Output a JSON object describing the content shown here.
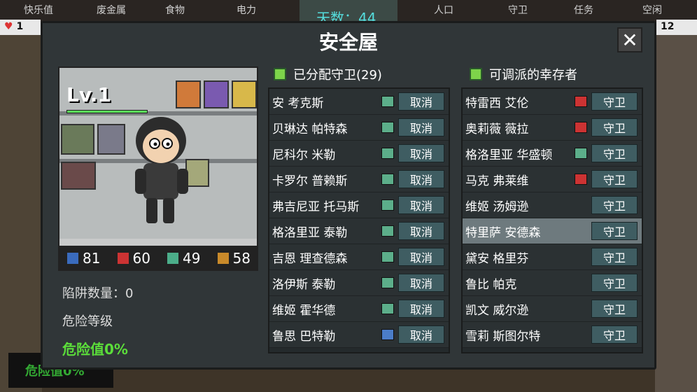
{
  "top": {
    "labels": [
      "快乐值",
      "废金属",
      "食物",
      "电力",
      "人口",
      "守卫",
      "任务",
      "空闲"
    ],
    "day_text": "天数：44",
    "left_stat": "1",
    "right_stat": "12"
  },
  "bottom": {
    "danger_text": "危险值0%"
  },
  "modal": {
    "title": "安全屋",
    "close": "✕",
    "level": "Lv.1",
    "stats": [
      {
        "icon": "book-icon",
        "value": "81",
        "color": "#3a6bbd"
      },
      {
        "icon": "rifle-icon",
        "value": "60",
        "color": "#c33"
      },
      {
        "icon": "pistol-icon",
        "value": "49",
        "color": "#4cae8a"
      },
      {
        "icon": "crate-icon",
        "value": "58",
        "color": "#c98a2a"
      }
    ],
    "trap_count": "陷阱数量：0",
    "danger_level": "危险等级",
    "danger_value": "危险值0%",
    "assigned": {
      "title": "已分配守卫(29)",
      "rows": [
        {
          "name": "安 考克斯",
          "icon": "green",
          "action": "取消"
        },
        {
          "name": "贝琳达 帕特森",
          "icon": "green",
          "action": "取消"
        },
        {
          "name": "尼科尔 米勒",
          "icon": "green",
          "action": "取消"
        },
        {
          "name": "卡罗尔 普赖斯",
          "icon": "green",
          "action": "取消"
        },
        {
          "name": "弗吉尼亚 托马斯",
          "icon": "green",
          "action": "取消"
        },
        {
          "name": "格洛里亚 泰勒",
          "icon": "green",
          "action": "取消"
        },
        {
          "name": "吉恩 理查德森",
          "icon": "green",
          "action": "取消"
        },
        {
          "name": "洛伊斯 泰勒",
          "icon": "green",
          "action": "取消"
        },
        {
          "name": "维姬 霍华德",
          "icon": "green",
          "action": "取消"
        },
        {
          "name": "鲁思 巴特勒",
          "icon": "blue",
          "action": "取消"
        }
      ]
    },
    "available": {
      "title": "可调派的幸存者",
      "rows": [
        {
          "name": "特雷西 艾伦",
          "icon": "red",
          "action": "守卫"
        },
        {
          "name": "奥莉薇 薇拉",
          "icon": "red",
          "action": "守卫"
        },
        {
          "name": "格洛里亚 华盛顿",
          "icon": "green",
          "action": "守卫"
        },
        {
          "name": "马克 弗莱维",
          "icon": "red",
          "action": "守卫"
        },
        {
          "name": "维姬 汤姆逊",
          "icon": "",
          "action": "守卫"
        },
        {
          "name": "特里萨 安德森",
          "icon": "",
          "action": "守卫"
        },
        {
          "name": "黛安 格里芬",
          "icon": "",
          "action": "守卫"
        },
        {
          "name": "鲁比 帕克",
          "icon": "",
          "action": "守卫"
        },
        {
          "name": "凯文 威尔逊",
          "icon": "",
          "action": "守卫"
        },
        {
          "name": "雪莉 斯图尔特",
          "icon": "",
          "action": "守卫"
        }
      ]
    }
  }
}
